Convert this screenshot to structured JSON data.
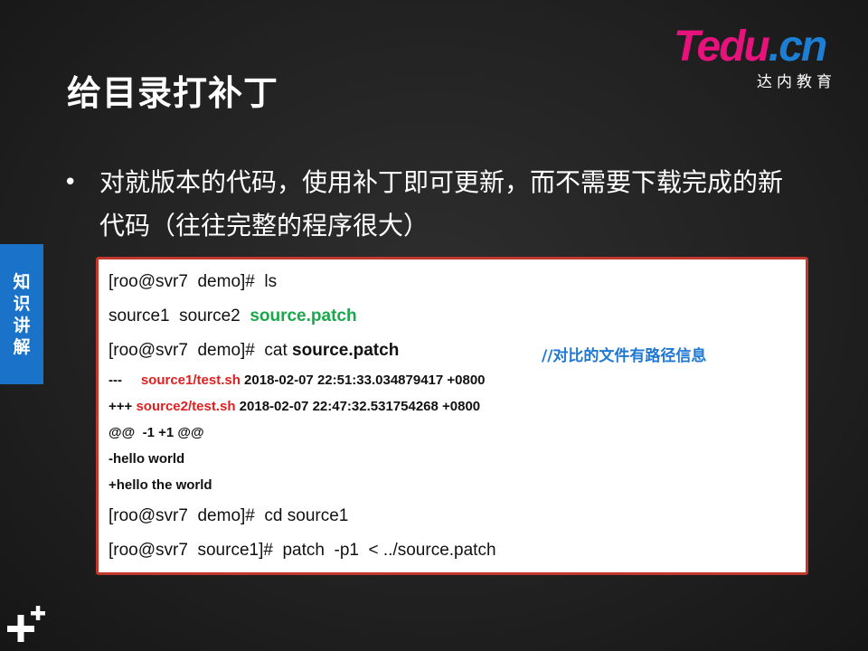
{
  "logo": {
    "brand": "Tedu",
    "tld": ".cn",
    "subtitle": "达内教育"
  },
  "title": "给目录打补丁",
  "bullet": {
    "marker": "•",
    "text": "对就版本的代码，使用补丁即可更新，而不需要下载完成的新代码（往往完整的程序很大）"
  },
  "side_tab": {
    "label": "知识讲解"
  },
  "terminal": {
    "line1": "[roo@svr7  demo]#  ls",
    "line2_files": "source1  source2  ",
    "line2_patch": "source.patch",
    "line3_cmd": "[roo@svr7  demo]#  cat ",
    "line3_file": "source.patch",
    "comment": "//对比的文件有路径信息",
    "line4_prefix": "---     ",
    "line4_file": "source1/test.sh",
    "line4_time": " 2018-02-07 22:51:33.034879417 +0800",
    "line5_prefix": "+++ ",
    "line5_file": "source2/test.sh",
    "line5_time": " 2018-02-07 22:47:32.531754268 +0800",
    "line6": "@@  -1 +1 @@",
    "line7": "-hello world",
    "line8": "+hello the world",
    "line9": "[roo@svr7  demo]#  cd source1",
    "line10": "[roo@svr7  source1]#  patch  -p1  < ../source.patch"
  },
  "colors": {
    "tab_blue": "#1a73c9",
    "border_red": "#c0392b",
    "green": "#1aa84b",
    "red": "#e02020",
    "comment_blue": "#1e78d4",
    "brand_pink": "#e8127c"
  }
}
